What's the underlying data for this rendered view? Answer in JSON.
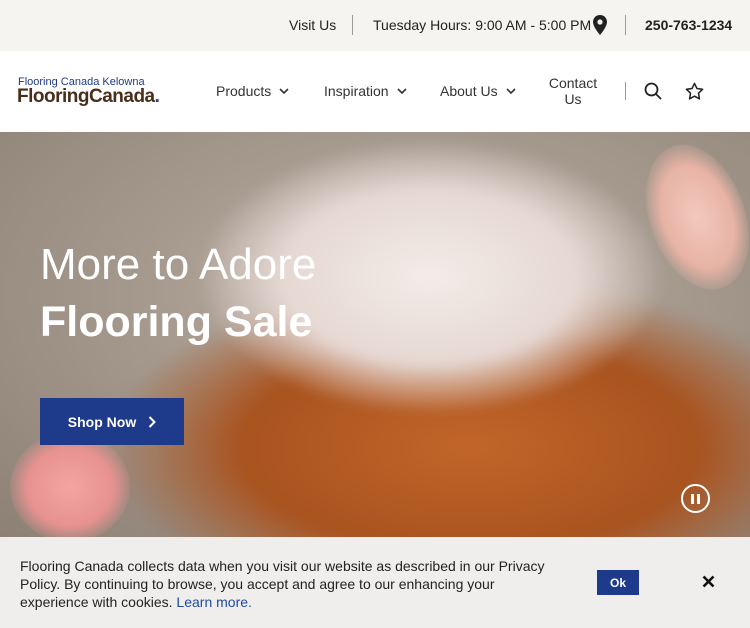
{
  "topbar": {
    "visit_label": "Visit Us",
    "hours_label": "Tuesday Hours: 9:00 AM - 5:00 PM",
    "phone": "250-763-1234",
    "icon": "map-pin-icon"
  },
  "header": {
    "logo_subtitle": "Flooring Canada Kelowna",
    "logo_name": "FlooringCanada",
    "logo_dot": ".",
    "nav": {
      "products": "Products",
      "inspiration": "Inspiration",
      "about": "About Us",
      "contact_line1": "Contact",
      "contact_line2": "Us"
    },
    "icons": [
      "chevron-down-icon",
      "search-icon",
      "star-icon"
    ]
  },
  "hero": {
    "line1": "More to Adore",
    "line2": "Flooring Sale",
    "cta_label": "Shop Now",
    "icons": [
      "chevron-right-icon",
      "pause-icon"
    ]
  },
  "cookie": {
    "text": "Flooring Canada collects data when you visit our website as described in our Privacy Policy. By continuing to browse, you accept and agree to our enhancing your experience with cookies.",
    "link_label": "Learn more.",
    "ok_label": "Ok",
    "icon": "close-icon"
  },
  "colors": {
    "brand_blue": "#1e3a8a",
    "logo_brown": "#4a2e1c",
    "topbar_bg": "#f5f4f1",
    "cookie_bg": "#efeeec"
  }
}
